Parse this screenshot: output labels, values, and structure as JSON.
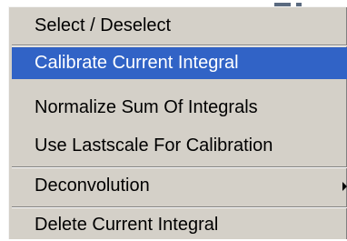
{
  "context_menu": {
    "items": [
      {
        "label": "Select / Deselect"
      },
      {
        "label": "Calibrate Current Integral"
      },
      {
        "label": "Normalize Sum Of Integrals"
      },
      {
        "label": "Use Lastscale For Calibration"
      },
      {
        "label": "Deconvolution"
      },
      {
        "label": "Delete Current Integral"
      }
    ],
    "highlighted_item": "Calibrate Current Integral",
    "submenu_icon": "chevron-right-icon",
    "colors": {
      "menu_background": "#d4d0c8",
      "highlight_background": "#3163c6",
      "highlight_text": "#ffffff",
      "text": "#000000"
    }
  }
}
